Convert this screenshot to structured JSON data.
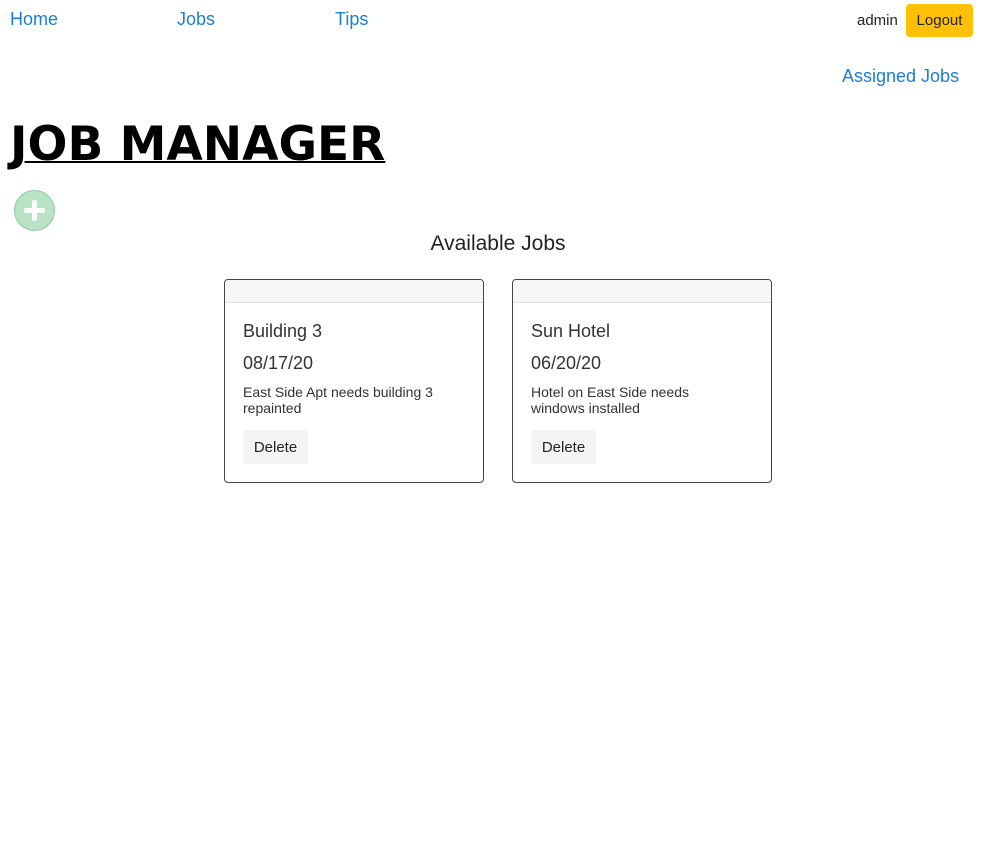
{
  "nav": {
    "home": "Home",
    "jobs": "Jobs",
    "tips": "Tips",
    "user": "admin",
    "logout": "Logout",
    "assigned_jobs": "Assigned Jobs"
  },
  "header": {
    "title": "JOB MANAGER"
  },
  "main": {
    "add_icon": "plus-circle-icon",
    "section_title": "Available Jobs",
    "jobs": [
      {
        "title": "Building 3",
        "date": "08/17/20",
        "description": "East Side Apt needs building 3 repainted",
        "delete_label": "Delete"
      },
      {
        "title": "Sun Hotel",
        "date": "06/20/20",
        "description": "Hotel on East Side needs windows installed",
        "delete_label": "Delete"
      }
    ]
  },
  "colors": {
    "link": "#1a7fd6",
    "logout_button": "#ffc107",
    "add_button": "#b9e3c4"
  }
}
